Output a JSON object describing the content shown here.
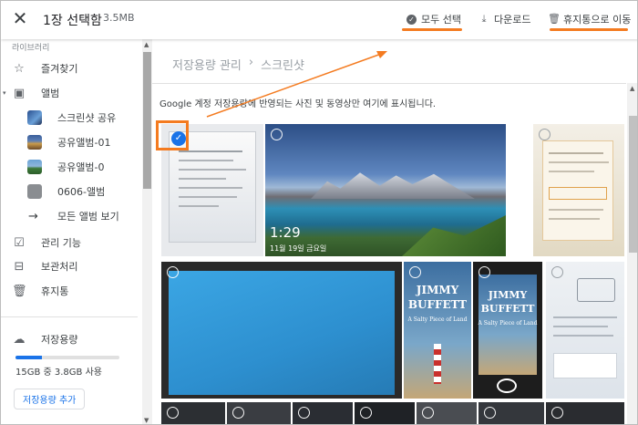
{
  "topbar": {
    "title": "1장 선택함",
    "size": "3.5MB",
    "select_all": "모두 선택",
    "download": "다운로드",
    "trash": "휴지통으로 이동"
  },
  "sidebar": {
    "section_label": "라이브러리",
    "items": [
      {
        "label": "즐겨찾기",
        "icon": "star-icon"
      },
      {
        "label": "앨범",
        "icon": "album-icon"
      },
      {
        "label": "스크린샷 공유",
        "icon": "album-thumb"
      },
      {
        "label": "공유앨범-01",
        "icon": "album-thumb"
      },
      {
        "label": "공유앨범-0",
        "icon": "album-thumb"
      },
      {
        "label": "0606-앨범",
        "icon": "album-thumb"
      },
      {
        "label": "모든 앨범 보기",
        "icon": "arrow-right-icon"
      },
      {
        "label": "관리 기능",
        "icon": "check-square-icon"
      },
      {
        "label": "보관처리",
        "icon": "archive-icon"
      },
      {
        "label": "휴지통",
        "icon": "trash-icon"
      }
    ],
    "storage": {
      "label": "저장용량",
      "usage": "15GB 중 3.8GB 사용",
      "used_fraction": 0.25,
      "button": "저장용량 추가"
    }
  },
  "main": {
    "breadcrumb": [
      "저장용량 관리",
      "›",
      "스크린샷"
    ],
    "info": "Google 계정 저장용량에 반영되는 사진 및 동영상만 여기에 표시됩니다.",
    "photos": {
      "lake": {
        "time": "1:29",
        "date": "11월 19일 금요일"
      },
      "book1": {
        "line1": "JIMMY",
        "line2": "BUFFETT",
        "sub": "A Salty Piece of Land"
      },
      "book2": {
        "line1": "JIMMY",
        "line2": "BUFFETT",
        "sub": "A Salty Piece of Land"
      }
    }
  },
  "colors": {
    "accent": "#1a73e8",
    "annotation": "#f47b20"
  }
}
